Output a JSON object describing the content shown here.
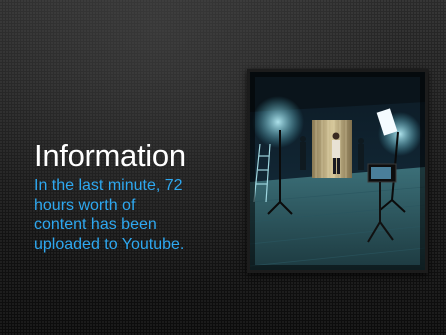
{
  "slide": {
    "title": "Information",
    "body_lines": [
      "In the last minute, 72",
      "hours worth of",
      "content has been",
      "uploaded to Youtube."
    ]
  },
  "colors": {
    "background": "#151515",
    "title": "#ffffff",
    "body": "#2ea8f0"
  },
  "photo": {
    "icon": "studio-photo"
  }
}
